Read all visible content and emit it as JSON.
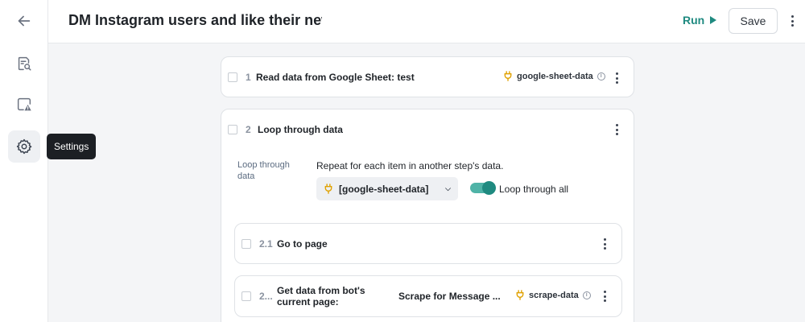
{
  "nav": {
    "back_icon": "arrow-left-icon",
    "items": [
      {
        "icon": "document-search-icon"
      },
      {
        "icon": "warning-window-icon"
      },
      {
        "icon": "gear-icon",
        "active": true
      }
    ],
    "tooltip": "Settings"
  },
  "header": {
    "title": "DM Instagram users and like their newes",
    "run_label": "Run",
    "save_label": "Save"
  },
  "steps": [
    {
      "number": "1",
      "title": "Read data from Google Sheet: test",
      "variable": "google-sheet-data"
    },
    {
      "number": "2",
      "title": "Loop through data",
      "loop": {
        "label": "Loop through data",
        "description": "Repeat for each item in another step's data.",
        "selected": "[google-sheet-data]",
        "toggle_label": "Loop through all",
        "toggle_on": true
      },
      "children": [
        {
          "number": "2.1",
          "title": "Go to page"
        },
        {
          "number": "2...",
          "title": "Get data from bot's current page:",
          "subtitle": "Scrape for Message ...",
          "variable": "scrape-data"
        }
      ]
    }
  ],
  "colors": {
    "accent": "#1f8a80",
    "variable_icon": "#e0a100",
    "tooltip_bg": "#1c1f24"
  }
}
